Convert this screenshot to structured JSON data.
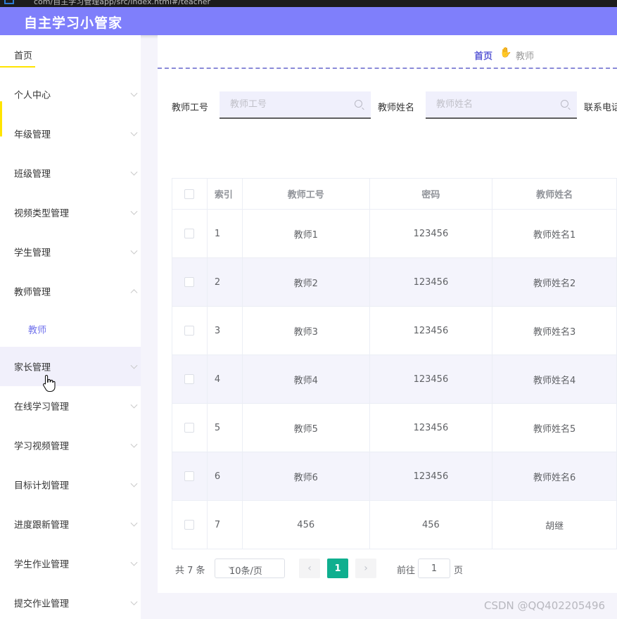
{
  "browser": {
    "url_fragment": "com/自主学习管理app/src/index.html#/teacher"
  },
  "header": {
    "title": "自主学习小管家"
  },
  "sidebar": {
    "home": "首页",
    "items": [
      {
        "label": "个人中心"
      },
      {
        "label": "年级管理"
      },
      {
        "label": "班级管理"
      },
      {
        "label": "视频类型管理"
      },
      {
        "label": "学生管理"
      },
      {
        "label": "教师管理"
      },
      {
        "label": "家长管理"
      },
      {
        "label": "在线学习管理"
      },
      {
        "label": "学习视频管理"
      },
      {
        "label": "目标计划管理"
      },
      {
        "label": "进度跟新管理"
      },
      {
        "label": "学生作业管理"
      },
      {
        "label": "提交作业管理"
      }
    ],
    "sub_item": "教师"
  },
  "breadcrumb": {
    "home": "首页",
    "current": "教师",
    "separator": "✋"
  },
  "search": {
    "field1_label": "教师工号",
    "field1_placeholder": "教师工号",
    "field2_label": "教师姓名",
    "field2_placeholder": "教师姓名",
    "field3_label": "联系电话"
  },
  "table": {
    "headers": [
      "索引",
      "教师工号",
      "密码",
      "教师姓名"
    ],
    "rows": [
      [
        "1",
        "教师1",
        "123456",
        "教师姓名1"
      ],
      [
        "2",
        "教师2",
        "123456",
        "教师姓名2"
      ],
      [
        "3",
        "教师3",
        "123456",
        "教师姓名3"
      ],
      [
        "4",
        "教师4",
        "123456",
        "教师姓名4"
      ],
      [
        "5",
        "教师5",
        "123456",
        "教师姓名5"
      ],
      [
        "6",
        "教师6",
        "123456",
        "教师姓名6"
      ],
      [
        "7",
        "456",
        "456",
        "胡继"
      ]
    ]
  },
  "pagination": {
    "total": "共 7 条",
    "page_size": "10条/页",
    "prev": "‹",
    "next": "›",
    "current_page": "1",
    "goto_label": "前往",
    "goto_value": "1",
    "page_suffix": "页"
  },
  "watermark": "CSDN @QQ402205496",
  "colors": {
    "header": "#7f7ffb",
    "accent": "#7071ec",
    "active_page": "#0faf8f",
    "highlight": "#ffe400"
  }
}
